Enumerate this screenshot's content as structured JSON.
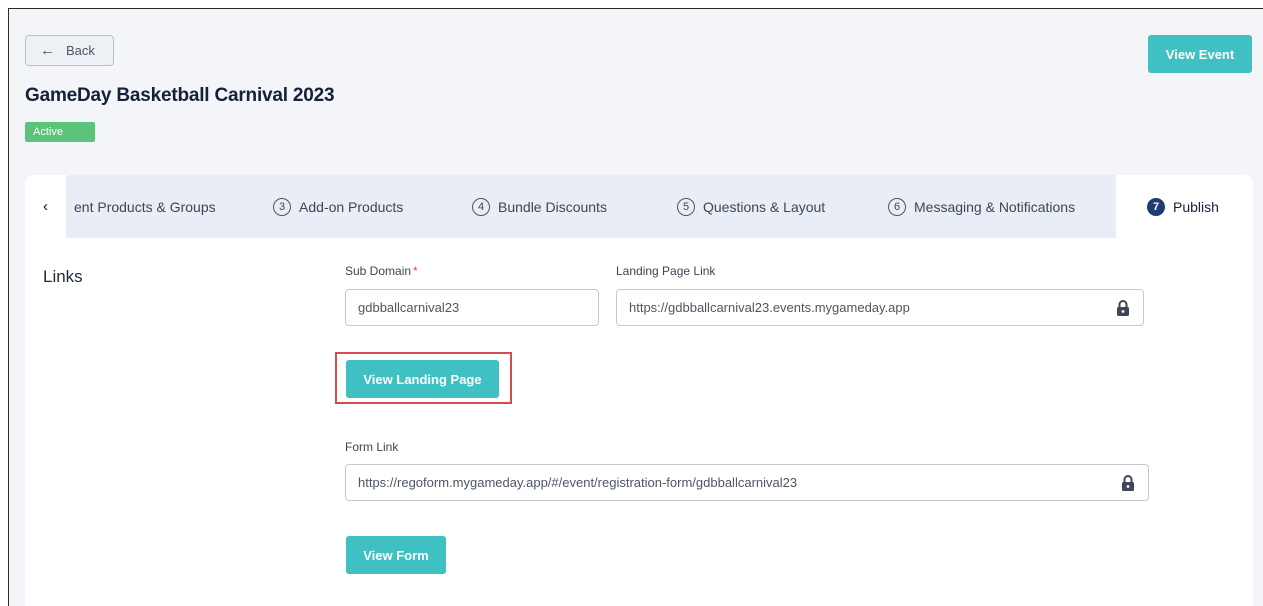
{
  "header": {
    "back_label": "Back",
    "back_icon": "arrow-left-icon",
    "view_event_label": "View Event",
    "title": "GameDay Basketball Carnival 2023",
    "status": "Active"
  },
  "steps": {
    "prev_icon": "chevron-left-icon",
    "items": [
      {
        "number": "",
        "label": "ent Products & Groups"
      },
      {
        "number": "3",
        "label": "Add-on Products"
      },
      {
        "number": "4",
        "label": "Bundle Discounts"
      },
      {
        "number": "5",
        "label": "Questions & Layout"
      },
      {
        "number": "6",
        "label": "Messaging & Notifications"
      },
      {
        "number": "7",
        "label": "Publish"
      }
    ]
  },
  "links": {
    "section_title": "Links",
    "subdomain": {
      "label": "Sub Domain",
      "required_mark": "*",
      "value": "gdbballcarnival23"
    },
    "landing_page": {
      "label": "Landing Page Link",
      "value": "https://gdbballcarnival23.events.mygameday.app",
      "icon": "lock-icon"
    },
    "view_landing_label": "View Landing Page",
    "form_link": {
      "label": "Form Link",
      "value": "https://regoform.mygameday.app/#/event/registration-form/gdbballcarnival23",
      "icon": "lock-icon"
    },
    "view_form_label": "View Form"
  },
  "colors": {
    "accent": "#3fc1c3",
    "active_badge": "#5cc47a",
    "step_active": "#1f3b73",
    "highlight": "#d64d4d"
  }
}
